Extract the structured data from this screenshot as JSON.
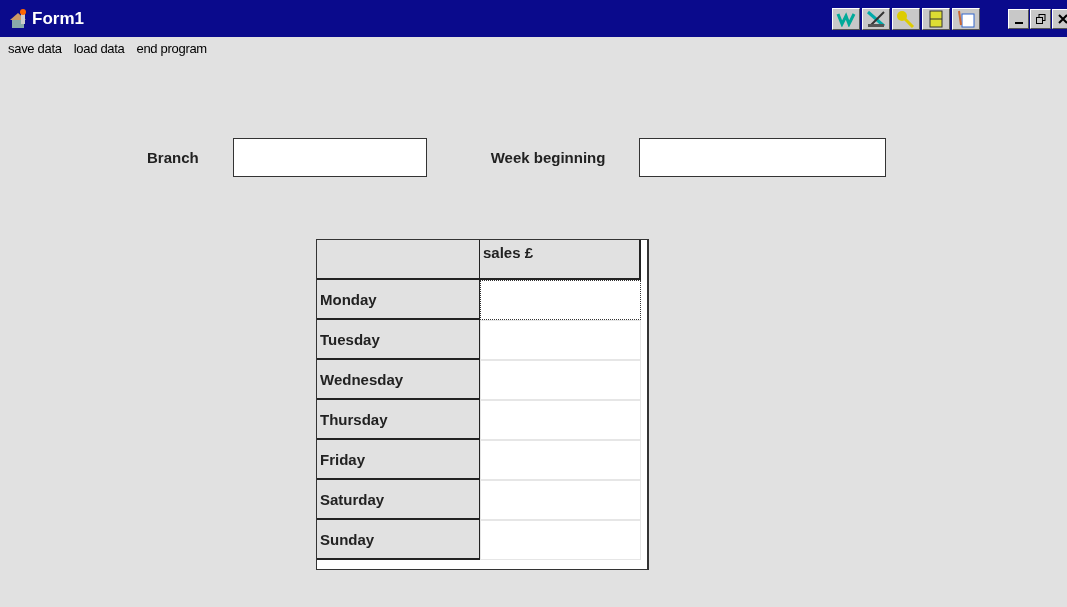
{
  "window": {
    "title": "Form1"
  },
  "menu": [
    "save data",
    "load data",
    "end program"
  ],
  "fields": [
    {
      "label": "Branch"
    },
    {
      "label": "Week beginning"
    }
  ],
  "grid": {
    "columns": [
      "sales £"
    ],
    "rows": [
      {
        "day": "Monday",
        "selected": true
      },
      {
        "day": "Tuesday",
        "selected": false
      },
      {
        "day": "Wednesday",
        "selected": false
      },
      {
        "day": "Thursday",
        "selected": false
      },
      {
        "day": "Friday",
        "selected": false
      },
      {
        "day": "Saturday",
        "selected": false
      },
      {
        "day": "Sunday",
        "selected": false
      }
    ]
  }
}
